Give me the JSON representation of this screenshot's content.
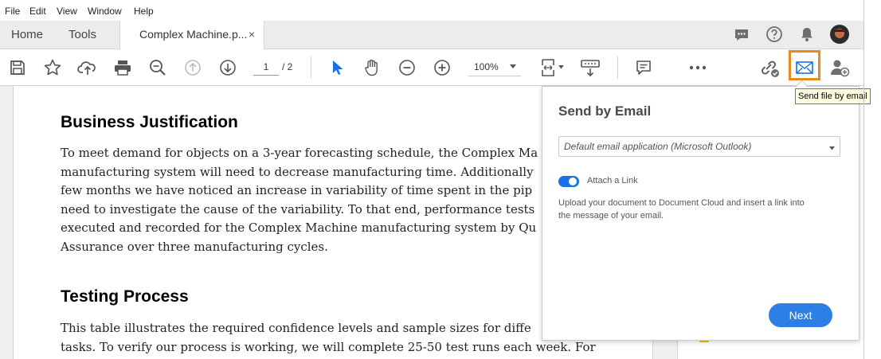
{
  "menu": [
    "File",
    "Edit",
    "View",
    "Window",
    "Help"
  ],
  "tabs": {
    "home": "Home",
    "tools": "Tools",
    "document": "Complex Machine.p...",
    "close_glyph": "×"
  },
  "toolbar": {
    "page_current": "1",
    "page_total": "/ 2",
    "zoom": "100%"
  },
  "document": {
    "heading1": "Business Justification",
    "para1": [
      "To meet demand for objects on a 3-year forecasting schedule, the Complex Ma",
      "manufacturing system will need to decrease manufacturing time. Additionally",
      "few months we have noticed an increase in variability of time spent in the pip",
      "need to investigate the cause of the variability. To that end, performance tests",
      "executed and recorded for the Complex Machine manufacturing system by Qu",
      "Assurance over three manufacturing cycles."
    ],
    "heading2": "Testing Process",
    "para2": [
      "This table illustrates the required confidence levels and sample sizes for diffe",
      "tasks. To verify our process is working, we will complete 25-50 test runs each week. For"
    ]
  },
  "popup": {
    "title": "Send by Email",
    "select_value": "Default email application (Microsoft Outlook)",
    "toggle_label": "Attach a Link",
    "toggle_on": true,
    "description_line1": "Upload your document to Document Cloud and insert a link into",
    "description_line2": "the message of your email.",
    "next_label": "Next"
  },
  "tooltip": "Send file by email",
  "colors": {
    "accent": "#1473e6",
    "highlight": "#e8891c",
    "next_button": "#2d7fe6"
  }
}
